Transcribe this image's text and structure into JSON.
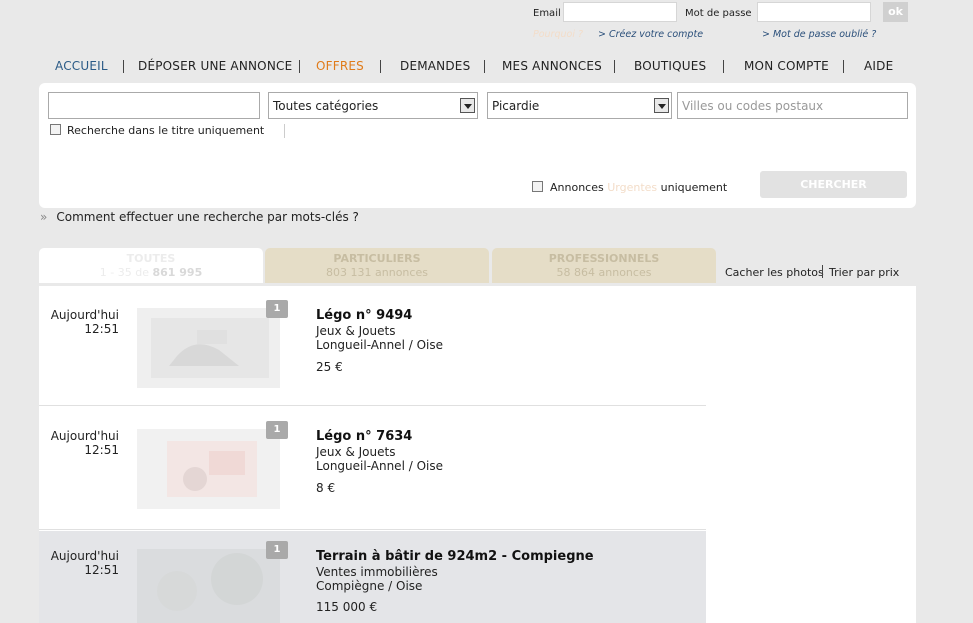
{
  "login": {
    "email_label": "Email",
    "password_label": "Mot de passe",
    "ok_label": "ok",
    "faint_link": "Pourquoi ?",
    "create_account": "> Créez votre compte",
    "forgot_password": "> Mot de passe oublié ?"
  },
  "nav": {
    "items": [
      "ACCUEIL",
      "DÉPOSER UNE ANNONCE",
      "OFFRES",
      "DEMANDES",
      "MES ANNONCES",
      "BOUTIQUES",
      "MON COMPTE",
      "AIDE"
    ]
  },
  "search": {
    "keyword_value": "",
    "category_value": "Toutes catégories",
    "region_value": "Picardie",
    "city_placeholder": "Villes ou codes postaux",
    "title_only_label": "Recherche dans le titre uniquement",
    "urgent_pre": "Annonces",
    "urgent_mid": "Urgentes",
    "urgent_post": "uniquement",
    "submit_label": "CHERCHER"
  },
  "howto": {
    "arrow": "»",
    "text": "Comment effectuer une recherche par mots-clés ?"
  },
  "tabs": [
    {
      "title": "TOUTES",
      "sub_pre": "1 - 35 de ",
      "sub_bold": "861 995"
    },
    {
      "title": "PARTICULIERS",
      "sub": "803 131 annonces"
    },
    {
      "title": "PROFESSIONNELS",
      "sub": "58 864 annonces"
    }
  ],
  "tab_links": {
    "hide_photos": "Cacher les photos",
    "sort_price": "Trier par prix"
  },
  "ads": [
    {
      "date": "Aujourd'hui",
      "time": "12:51",
      "photo_count": "1",
      "title": "Légo n° 9494",
      "category": "Jeux & Jouets",
      "location": "Longueil-Annel / Oise",
      "price": "25 €"
    },
    {
      "date": "Aujourd'hui",
      "time": "12:51",
      "photo_count": "1",
      "title": "Légo n° 7634",
      "category": "Jeux & Jouets",
      "location": "Longueil-Annel / Oise",
      "price": "8 €"
    },
    {
      "date": "Aujourd'hui",
      "time": "12:51",
      "photo_count": "1",
      "title": "Terrain à bâtir de 924m2 - Compiegne",
      "category": "Ventes immobilières",
      "location": "Compiègne / Oise",
      "price": "115 000 €"
    }
  ]
}
